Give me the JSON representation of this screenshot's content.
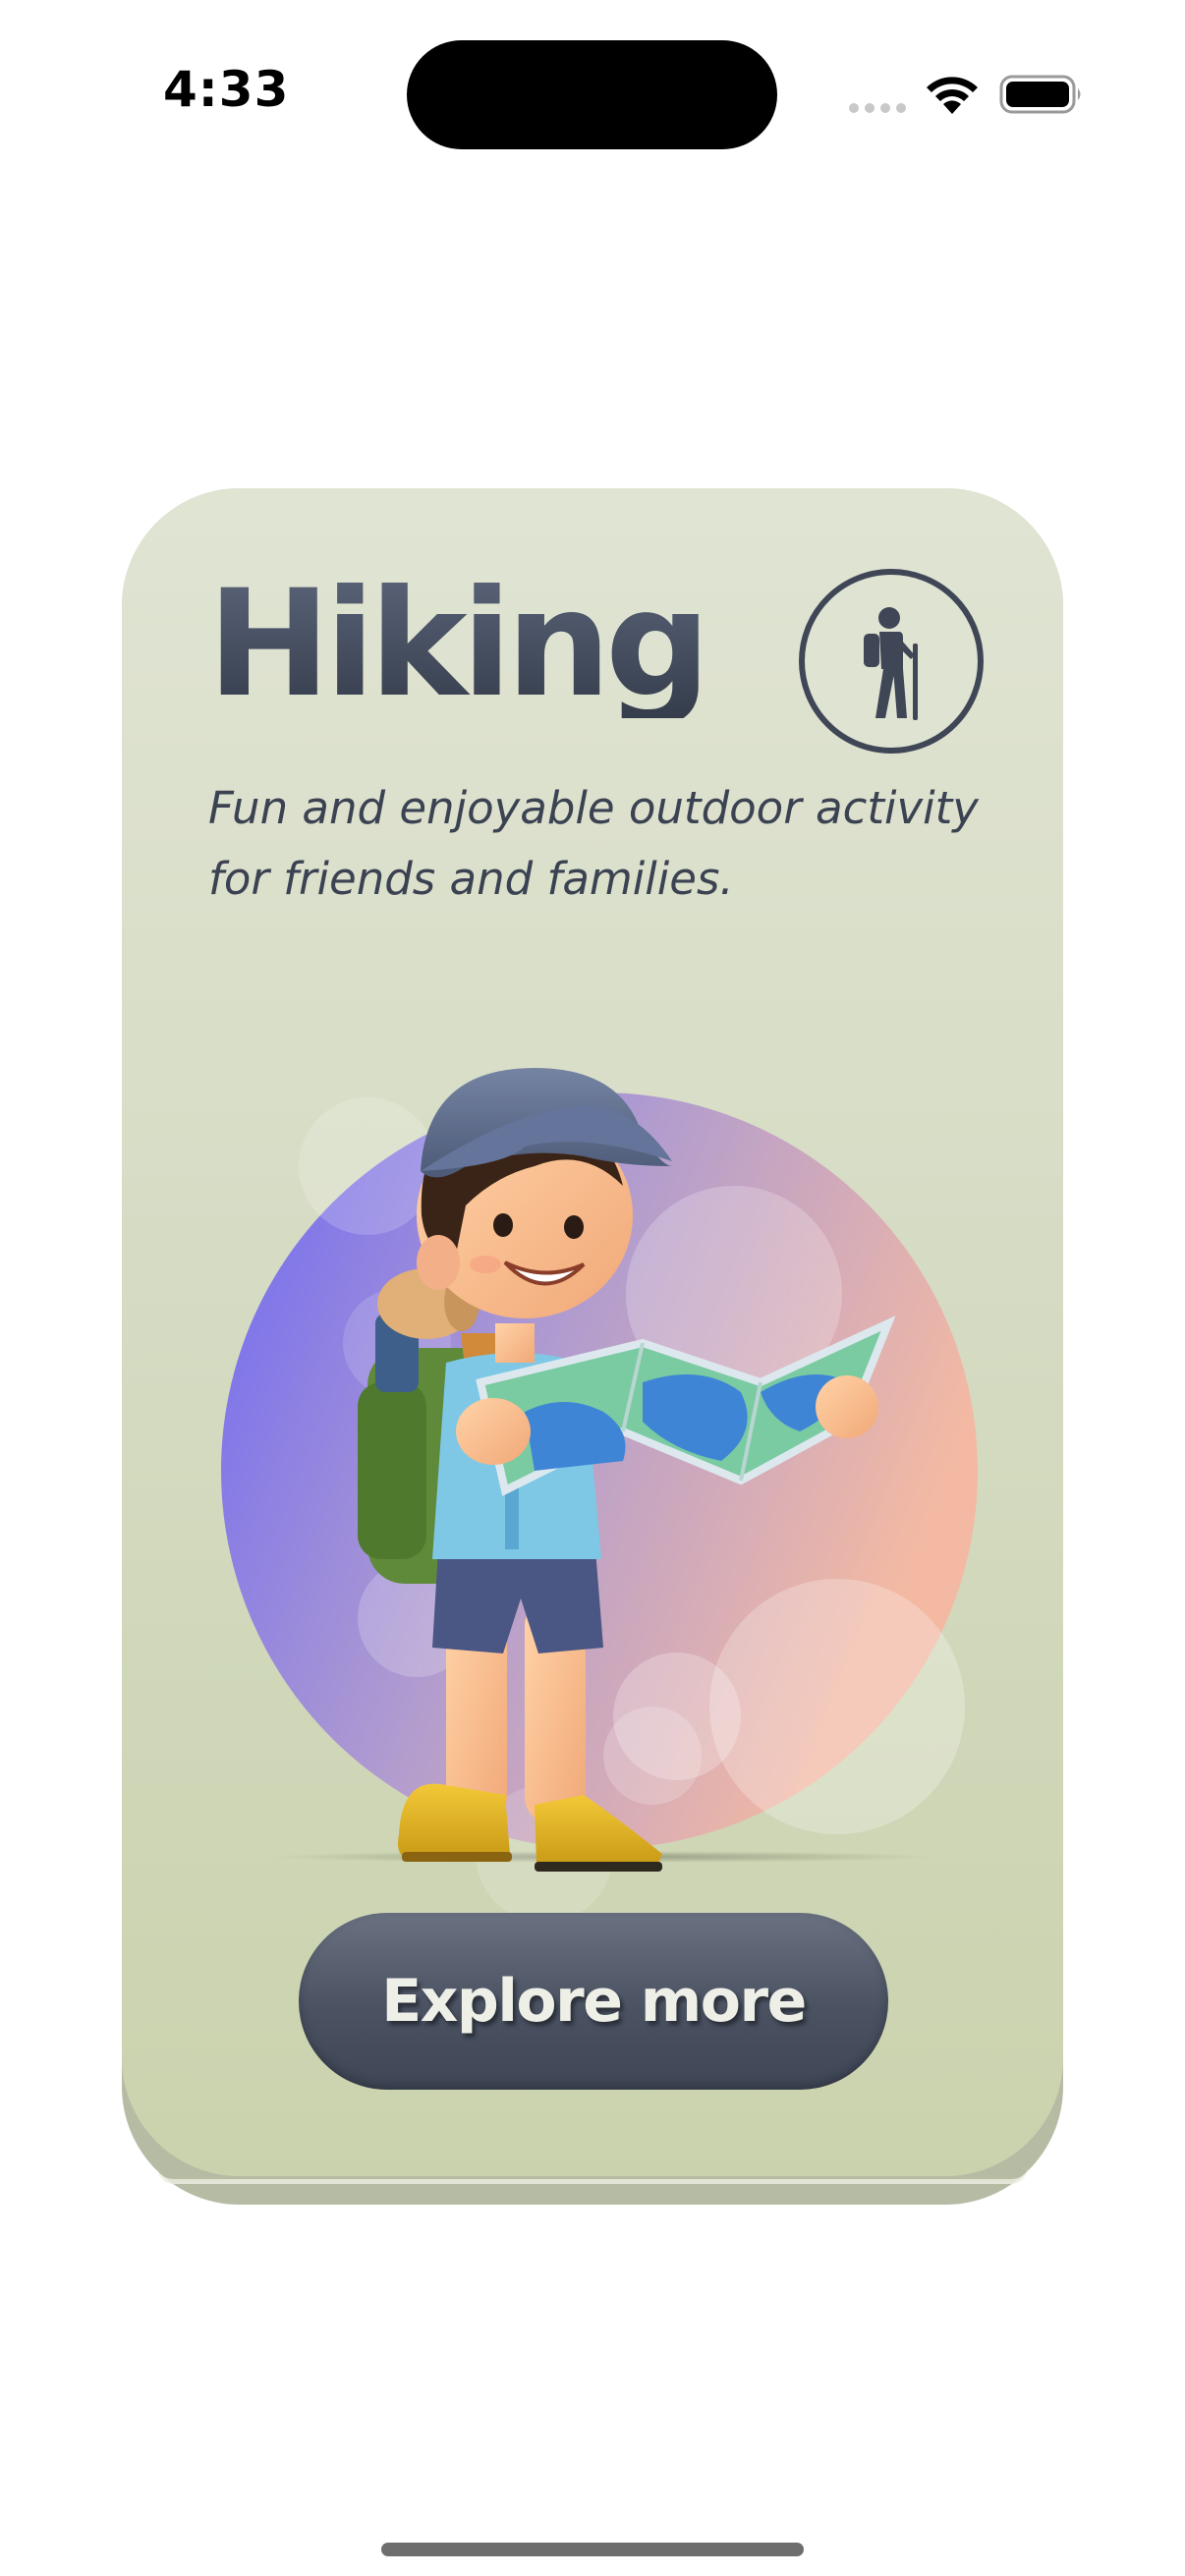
{
  "status_bar": {
    "time": "4:33"
  },
  "card": {
    "title": "Hiking",
    "description": "Fun and enjoyable outdoor activity for friends and families.",
    "badge_icon": "hiker-icon",
    "illustration": "boy-hiker-reading-map",
    "button_label": "Explore more"
  },
  "colors": {
    "card_background": "#d8dec7",
    "title": "#3b4252",
    "button": "#4a5262",
    "button_text": "#eef0e8",
    "circle_gradient": [
      "#6f6af2",
      "#a99ad4",
      "#f4b8a4"
    ]
  }
}
